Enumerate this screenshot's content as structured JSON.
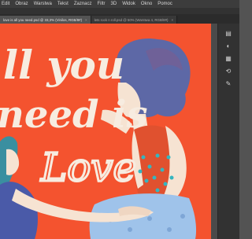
{
  "menubar": {
    "items": [
      "Edit",
      "Obraz",
      "Warstwa",
      "Tekst",
      "Zaznacz",
      "Filtr",
      "3D",
      "Widok",
      "Okno",
      "Pomoc"
    ]
  },
  "tabs": [
    {
      "label": "love is all you need.psd @ 33,3% (Vinilos, RGB/8#)",
      "close": "×",
      "active": true
    },
    {
      "label": "lets rock n roll.psd @ 50% (Warstwa 4, RGB/8#)",
      "close": "×",
      "active": false
    }
  ],
  "artwork": {
    "lettering_line1": "ll you",
    "lettering_line2": "need is",
    "lettering_line3": "Love"
  },
  "colors": {
    "background": "#f4532f",
    "lettering": "#f7ece0",
    "hair": "#5d68a6",
    "skin": "#f6e3d2",
    "dress_dots": "#35b5bf",
    "dress_bottom": "#9fc3ea"
  },
  "panels": {
    "icons": [
      "layers-icon",
      "adjust-icon",
      "swatches-icon",
      "history-icon",
      "paths-icon"
    ]
  }
}
